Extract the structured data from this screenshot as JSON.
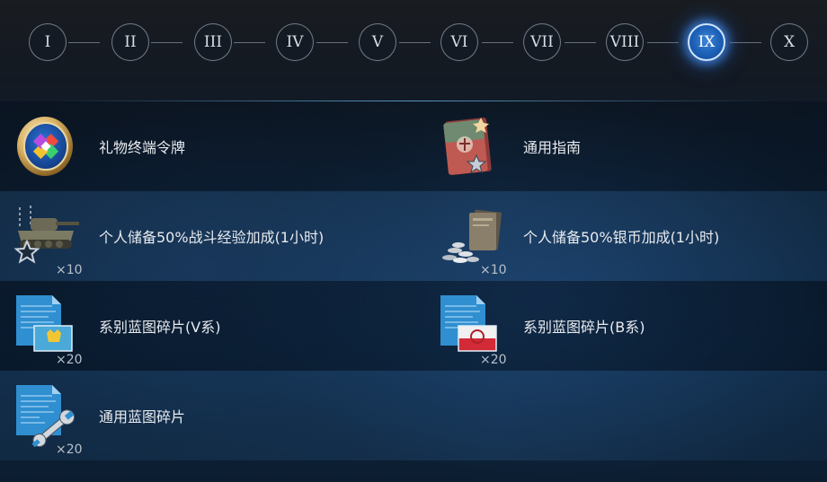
{
  "tiers": {
    "items": [
      "I",
      "II",
      "III",
      "IV",
      "V",
      "VI",
      "VII",
      "VIII",
      "IX",
      "X"
    ],
    "active": "IX"
  },
  "rewards": [
    {
      "name": "礼物终端令牌",
      "quantity": "",
      "icon": "gift-token-icon"
    },
    {
      "name": "通用指南",
      "quantity": "",
      "icon": "universal-guide-book-icon"
    },
    {
      "name": "个人储备50%战斗经验加成(1小时)",
      "quantity": "×10",
      "icon": "tank-xp-booster-icon"
    },
    {
      "name": "个人储备50%银币加成(1小时)",
      "quantity": "×10",
      "icon": "credits-booster-icon"
    },
    {
      "name": "系别蓝图碎片(V系)",
      "quantity": "×20",
      "icon": "swedish-blueprint-icon"
    },
    {
      "name": "系别蓝图碎片(B系)",
      "quantity": "×20",
      "icon": "polish-blueprint-icon"
    },
    {
      "name": "通用蓝图碎片",
      "quantity": "×20",
      "icon": "universal-blueprint-icon"
    }
  ],
  "colors": {
    "active_tier": "#1c5fb6",
    "glow": "#4696ff",
    "text": "#e8ebef"
  }
}
